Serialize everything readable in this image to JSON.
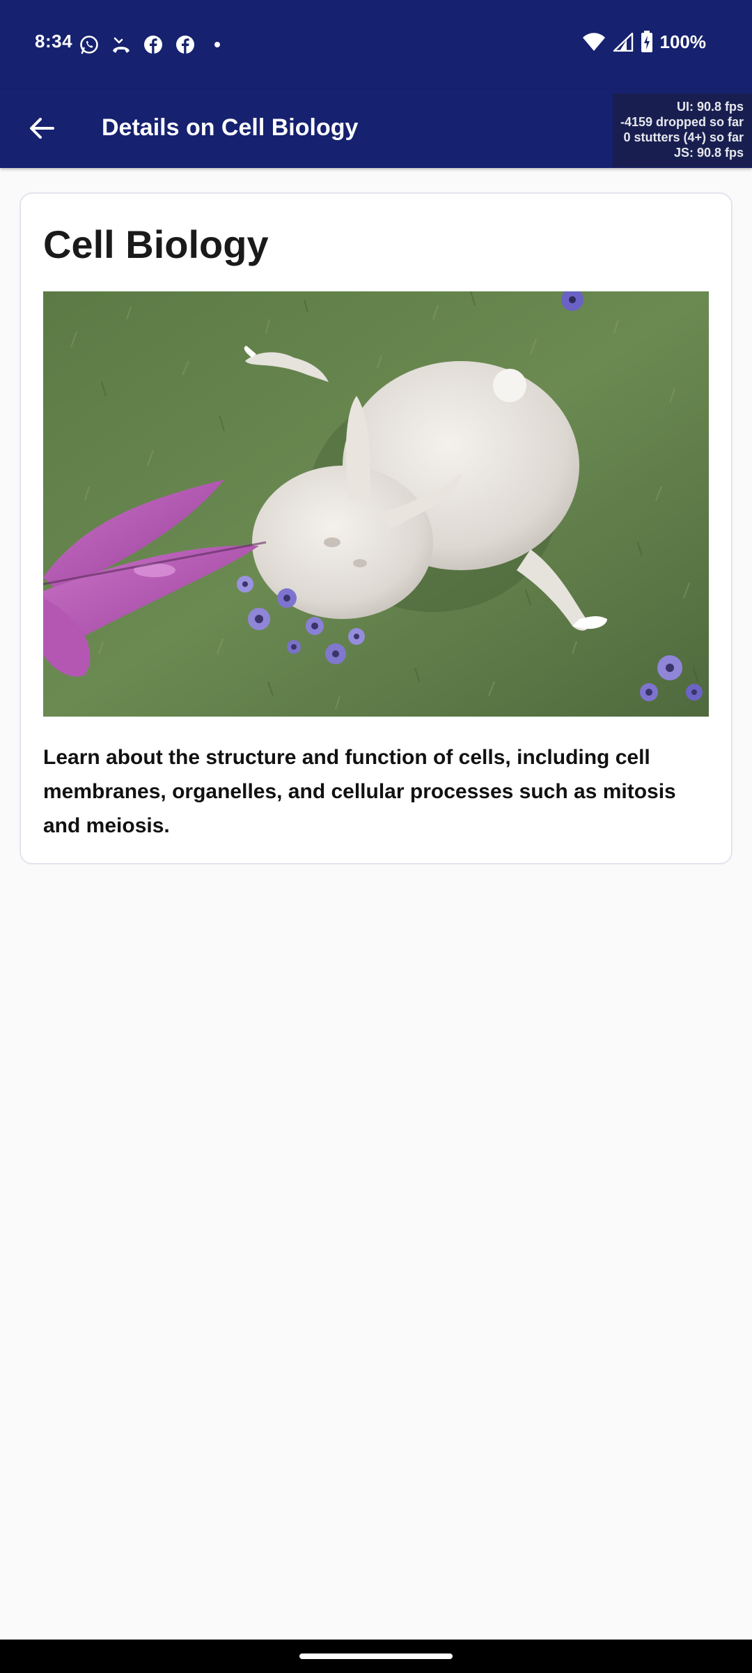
{
  "status_bar": {
    "time": "8:34",
    "left_icons": [
      "whatsapp-icon",
      "missed-call-icon",
      "facebook-icon",
      "facebook-icon",
      "notification-dot-icon"
    ],
    "right_icons": [
      "wifi-icon",
      "cell-signal-icon",
      "battery-charging-icon"
    ],
    "battery": "100%"
  },
  "app_bar": {
    "title": "Details on Cell Biology",
    "back_icon": "arrow-left-icon",
    "perf": {
      "ui_fps": "UI: 90.8 fps",
      "dropped": "-4159 dropped so far",
      "stutters": "0 stutters (4+) so far",
      "js_fps": "JS: 90.8 fps"
    }
  },
  "card": {
    "title": "Cell Biology",
    "description": "Learn about the structure and function of cells, including cell membranes, organelles, and cellular processes such as mitosis and meiosis."
  },
  "colors": {
    "primary": "#16216f",
    "background": "#fafafa",
    "card_border": "#e3e3ee"
  }
}
